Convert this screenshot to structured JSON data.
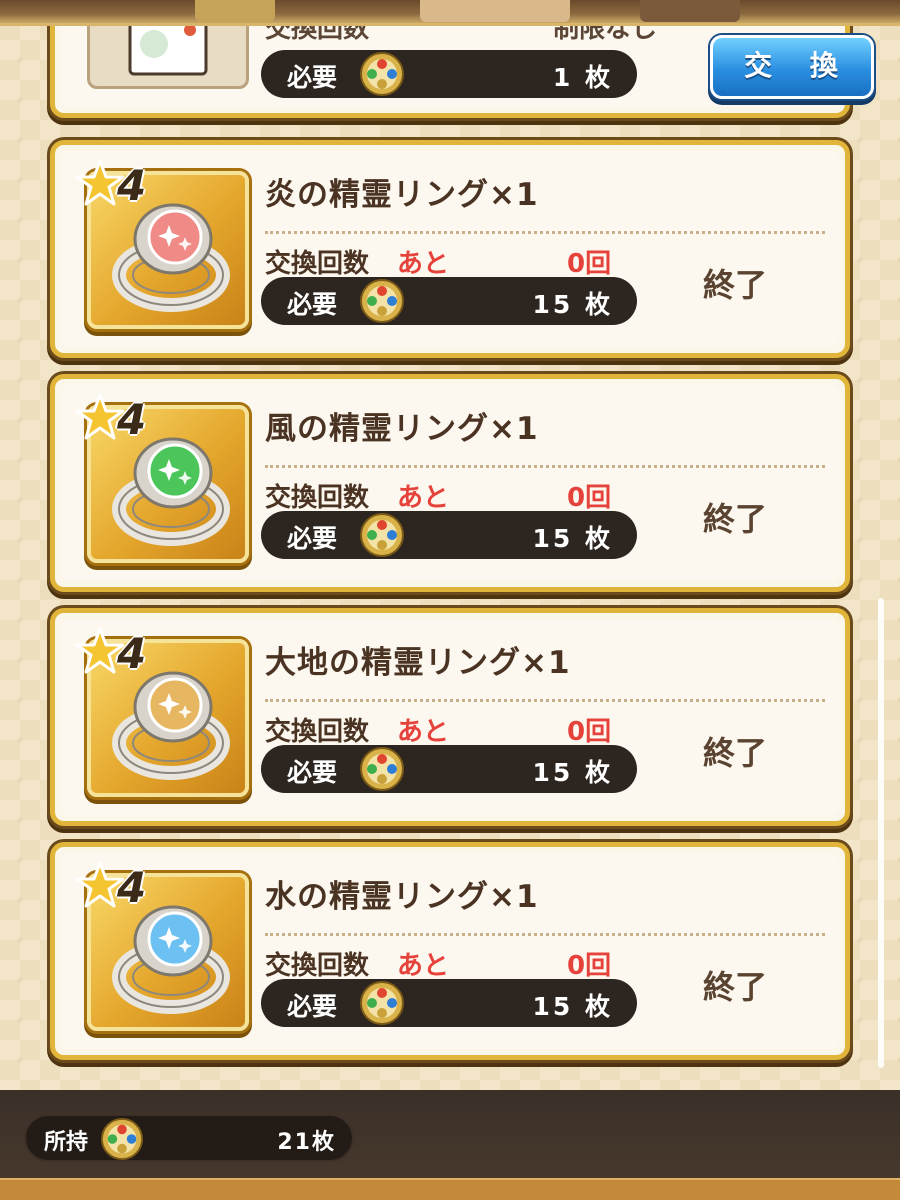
{
  "colors": {
    "card_border": "#e1b53a",
    "accent_red": "#e6423c",
    "button_blue": "#2a8fe0",
    "text_brown": "#4a3322"
  },
  "top_card": {
    "count_label": "交換回数",
    "count_status": "制限なし",
    "need_label": "必要",
    "need_value": "1 枚",
    "button_label": "交 換"
  },
  "items": [
    {
      "rarity": "4",
      "name": "炎の精霊リング×1",
      "gem_color": "#f08a86",
      "count_label": "交換回数",
      "count_prefix": "あと",
      "count_value": "0回",
      "need_label": "必要",
      "need_value": "15 枚",
      "status": "終了"
    },
    {
      "rarity": "4",
      "name": "風の精霊リング×1",
      "gem_color": "#4cc65a",
      "count_label": "交換回数",
      "count_prefix": "あと",
      "count_value": "0回",
      "need_label": "必要",
      "need_value": "15 枚",
      "status": "終了"
    },
    {
      "rarity": "4",
      "name": "大地の精霊リング×1",
      "gem_color": "#e6b760",
      "count_label": "交換回数",
      "count_prefix": "あと",
      "count_value": "0回",
      "need_label": "必要",
      "need_value": "15 枚",
      "status": "終了"
    },
    {
      "rarity": "4",
      "name": "水の精霊リング×1",
      "gem_color": "#6cc0f2",
      "count_label": "交換回数",
      "count_prefix": "あと",
      "count_value": "0回",
      "need_label": "必要",
      "need_value": "15 枚",
      "status": "終了"
    }
  ],
  "footer": {
    "owned_label": "所持",
    "owned_value": "21枚"
  },
  "icons": {
    "medal": "medal-icon",
    "star": "star-icon",
    "ring": "ring-icon"
  }
}
